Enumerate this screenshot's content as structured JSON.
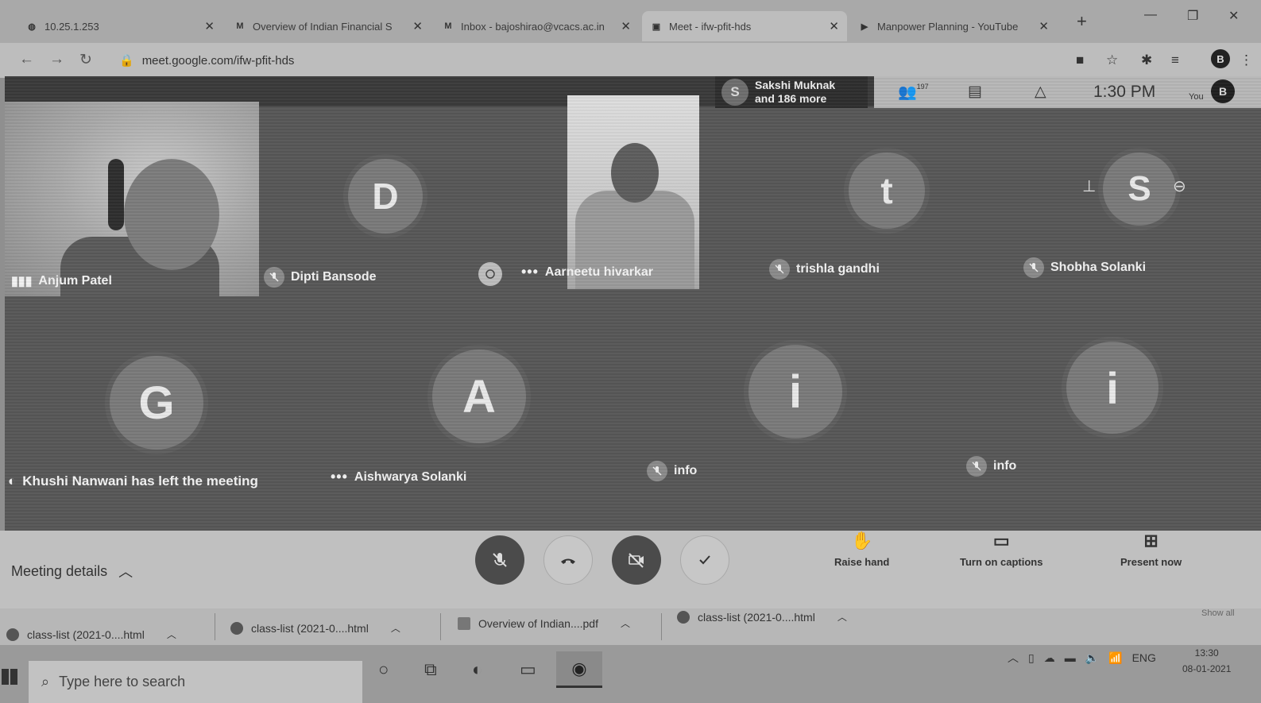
{
  "browser": {
    "tabs": [
      {
        "title": "10.25.1.253",
        "icon": "globe-icon",
        "closable": true
      },
      {
        "title": "Overview of Indian Financial S",
        "icon": "gmail-icon",
        "closable": true
      },
      {
        "title": "Inbox - bajoshirao@vcacs.ac.in",
        "icon": "gmail-icon",
        "closable": true
      },
      {
        "title": "Meet - ifw-pfit-hds",
        "icon": "meet-icon",
        "closable": true
      },
      {
        "title": "Manpower Planning - YouTube",
        "icon": "youtube-icon",
        "closable": true
      }
    ],
    "url": "meet.google.com/ifw-pfit-hds",
    "profile_initial": "B"
  },
  "meet": {
    "active_speaker": {
      "initial": "S",
      "line1": "Sakshi Muknak",
      "line2": "and 186 more"
    },
    "participant_count": "197",
    "clock": "1:30 PM",
    "you_label": "You",
    "you_initial": "B",
    "tiles": [
      {
        "name": "Anjum Patel",
        "type": "video"
      },
      {
        "name": "Dipti Bansode",
        "initial": "D"
      },
      {
        "name": "Aarneetu hivarkar",
        "type": "video"
      },
      {
        "name": "trishla gandhi",
        "initial": "t"
      },
      {
        "name": "Shobha Solanki",
        "initial": "S"
      },
      {
        "name": "Khushi Nanwani has left the meeting",
        "initial": "G"
      },
      {
        "name": "Aishwarya Solanki",
        "initial": "A"
      },
      {
        "name": "info",
        "initial": "i"
      },
      {
        "name": "info",
        "initial": "i"
      }
    ]
  },
  "controls": {
    "meeting_details": "Meeting details",
    "raise_hand": "Raise hand",
    "captions": "Turn on captions",
    "present": "Present now"
  },
  "downloads": {
    "items": [
      {
        "name": "class-list (2021-0....html",
        "type": "chrome"
      },
      {
        "name": "class-list (2021-0....html",
        "type": "chrome"
      },
      {
        "name": "Overview of Indian....pdf",
        "type": "pdf"
      },
      {
        "name": "class-list (2021-0....html",
        "type": "chrome"
      }
    ],
    "show_all": "Show all"
  },
  "taskbar": {
    "search_placeholder": "Type here to search",
    "language": "ENG",
    "time": "13:30",
    "date": "08-01-2021"
  }
}
